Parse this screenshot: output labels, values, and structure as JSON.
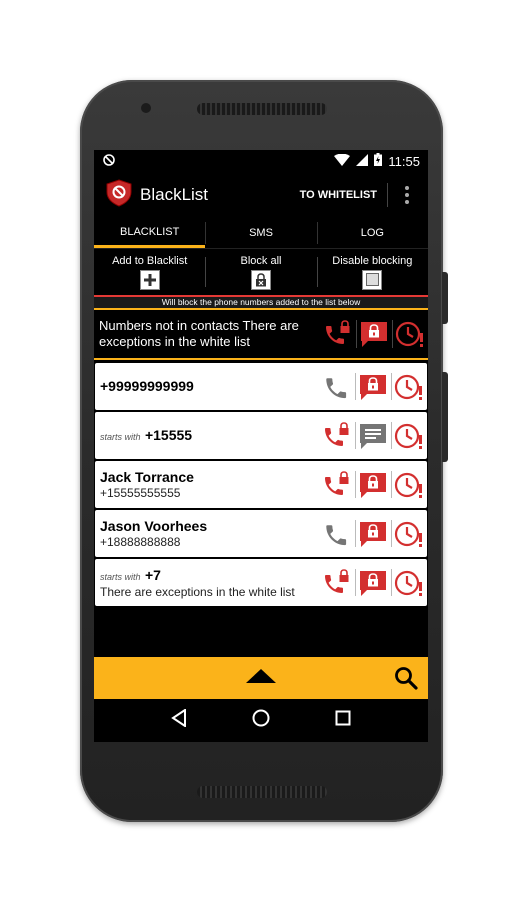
{
  "status": {
    "time": "11:55"
  },
  "app": {
    "title": "BlackList",
    "to_whitelist": "TO WHITELIST"
  },
  "tabs": [
    {
      "label": "BLACKLIST",
      "active": true
    },
    {
      "label": "SMS",
      "active": false
    },
    {
      "label": "LOG",
      "active": false
    }
  ],
  "actions": [
    {
      "label": "Add to Blacklist",
      "icon": "plus-icon"
    },
    {
      "label": "Block all",
      "icon": "lock-icon"
    },
    {
      "label": "Disable blocking",
      "icon": "checkbox-icon"
    }
  ],
  "info": "Will block the phone numbers added to the list below",
  "rows": [
    {
      "line1": "Numbers not in contacts There are exceptions in the white list"
    },
    {
      "line1": "+99999999999"
    },
    {
      "prefix": "starts with",
      "line1": "+15555"
    },
    {
      "line1": "Jack Torrance",
      "line2": "+15555555555"
    },
    {
      "line1": "Jason Voorhees",
      "line2": "+18888888888"
    },
    {
      "prefix": "starts with",
      "line1": "+7",
      "line2": "There are exceptions in the white list"
    }
  ],
  "colors": {
    "accent": "#fbb31a",
    "red": "#d32f2f",
    "gray": "#757575"
  }
}
